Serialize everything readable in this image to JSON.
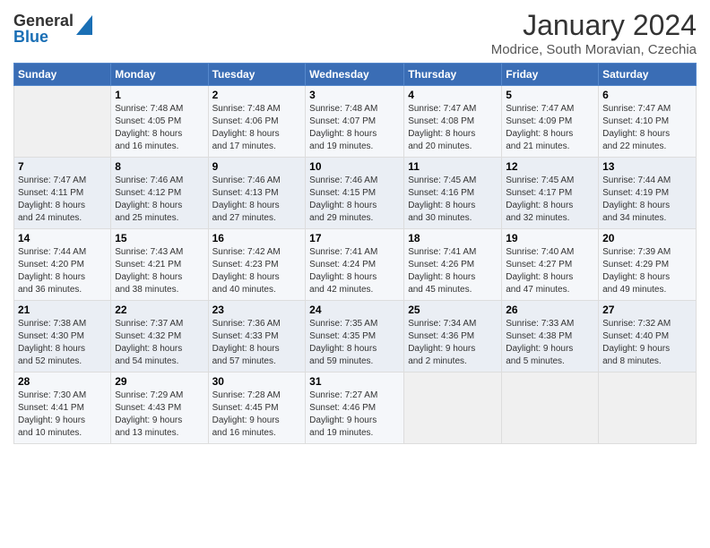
{
  "logo": {
    "general": "General",
    "blue": "Blue"
  },
  "header": {
    "month_title": "January 2024",
    "subtitle": "Modrice, South Moravian, Czechia"
  },
  "days_of_week": [
    "Sunday",
    "Monday",
    "Tuesday",
    "Wednesday",
    "Thursday",
    "Friday",
    "Saturday"
  ],
  "weeks": [
    [
      {
        "day": "",
        "info": ""
      },
      {
        "day": "1",
        "info": "Sunrise: 7:48 AM\nSunset: 4:05 PM\nDaylight: 8 hours\nand 16 minutes."
      },
      {
        "day": "2",
        "info": "Sunrise: 7:48 AM\nSunset: 4:06 PM\nDaylight: 8 hours\nand 17 minutes."
      },
      {
        "day": "3",
        "info": "Sunrise: 7:48 AM\nSunset: 4:07 PM\nDaylight: 8 hours\nand 19 minutes."
      },
      {
        "day": "4",
        "info": "Sunrise: 7:47 AM\nSunset: 4:08 PM\nDaylight: 8 hours\nand 20 minutes."
      },
      {
        "day": "5",
        "info": "Sunrise: 7:47 AM\nSunset: 4:09 PM\nDaylight: 8 hours\nand 21 minutes."
      },
      {
        "day": "6",
        "info": "Sunrise: 7:47 AM\nSunset: 4:10 PM\nDaylight: 8 hours\nand 22 minutes."
      }
    ],
    [
      {
        "day": "7",
        "info": "Sunrise: 7:47 AM\nSunset: 4:11 PM\nDaylight: 8 hours\nand 24 minutes."
      },
      {
        "day": "8",
        "info": "Sunrise: 7:46 AM\nSunset: 4:12 PM\nDaylight: 8 hours\nand 25 minutes."
      },
      {
        "day": "9",
        "info": "Sunrise: 7:46 AM\nSunset: 4:13 PM\nDaylight: 8 hours\nand 27 minutes."
      },
      {
        "day": "10",
        "info": "Sunrise: 7:46 AM\nSunset: 4:15 PM\nDaylight: 8 hours\nand 29 minutes."
      },
      {
        "day": "11",
        "info": "Sunrise: 7:45 AM\nSunset: 4:16 PM\nDaylight: 8 hours\nand 30 minutes."
      },
      {
        "day": "12",
        "info": "Sunrise: 7:45 AM\nSunset: 4:17 PM\nDaylight: 8 hours\nand 32 minutes."
      },
      {
        "day": "13",
        "info": "Sunrise: 7:44 AM\nSunset: 4:19 PM\nDaylight: 8 hours\nand 34 minutes."
      }
    ],
    [
      {
        "day": "14",
        "info": "Sunrise: 7:44 AM\nSunset: 4:20 PM\nDaylight: 8 hours\nand 36 minutes."
      },
      {
        "day": "15",
        "info": "Sunrise: 7:43 AM\nSunset: 4:21 PM\nDaylight: 8 hours\nand 38 minutes."
      },
      {
        "day": "16",
        "info": "Sunrise: 7:42 AM\nSunset: 4:23 PM\nDaylight: 8 hours\nand 40 minutes."
      },
      {
        "day": "17",
        "info": "Sunrise: 7:41 AM\nSunset: 4:24 PM\nDaylight: 8 hours\nand 42 minutes."
      },
      {
        "day": "18",
        "info": "Sunrise: 7:41 AM\nSunset: 4:26 PM\nDaylight: 8 hours\nand 45 minutes."
      },
      {
        "day": "19",
        "info": "Sunrise: 7:40 AM\nSunset: 4:27 PM\nDaylight: 8 hours\nand 47 minutes."
      },
      {
        "day": "20",
        "info": "Sunrise: 7:39 AM\nSunset: 4:29 PM\nDaylight: 8 hours\nand 49 minutes."
      }
    ],
    [
      {
        "day": "21",
        "info": "Sunrise: 7:38 AM\nSunset: 4:30 PM\nDaylight: 8 hours\nand 52 minutes."
      },
      {
        "day": "22",
        "info": "Sunrise: 7:37 AM\nSunset: 4:32 PM\nDaylight: 8 hours\nand 54 minutes."
      },
      {
        "day": "23",
        "info": "Sunrise: 7:36 AM\nSunset: 4:33 PM\nDaylight: 8 hours\nand 57 minutes."
      },
      {
        "day": "24",
        "info": "Sunrise: 7:35 AM\nSunset: 4:35 PM\nDaylight: 8 hours\nand 59 minutes."
      },
      {
        "day": "25",
        "info": "Sunrise: 7:34 AM\nSunset: 4:36 PM\nDaylight: 9 hours\nand 2 minutes."
      },
      {
        "day": "26",
        "info": "Sunrise: 7:33 AM\nSunset: 4:38 PM\nDaylight: 9 hours\nand 5 minutes."
      },
      {
        "day": "27",
        "info": "Sunrise: 7:32 AM\nSunset: 4:40 PM\nDaylight: 9 hours\nand 8 minutes."
      }
    ],
    [
      {
        "day": "28",
        "info": "Sunrise: 7:30 AM\nSunset: 4:41 PM\nDaylight: 9 hours\nand 10 minutes."
      },
      {
        "day": "29",
        "info": "Sunrise: 7:29 AM\nSunset: 4:43 PM\nDaylight: 9 hours\nand 13 minutes."
      },
      {
        "day": "30",
        "info": "Sunrise: 7:28 AM\nSunset: 4:45 PM\nDaylight: 9 hours\nand 16 minutes."
      },
      {
        "day": "31",
        "info": "Sunrise: 7:27 AM\nSunset: 4:46 PM\nDaylight: 9 hours\nand 19 minutes."
      },
      {
        "day": "",
        "info": ""
      },
      {
        "day": "",
        "info": ""
      },
      {
        "day": "",
        "info": ""
      }
    ]
  ]
}
